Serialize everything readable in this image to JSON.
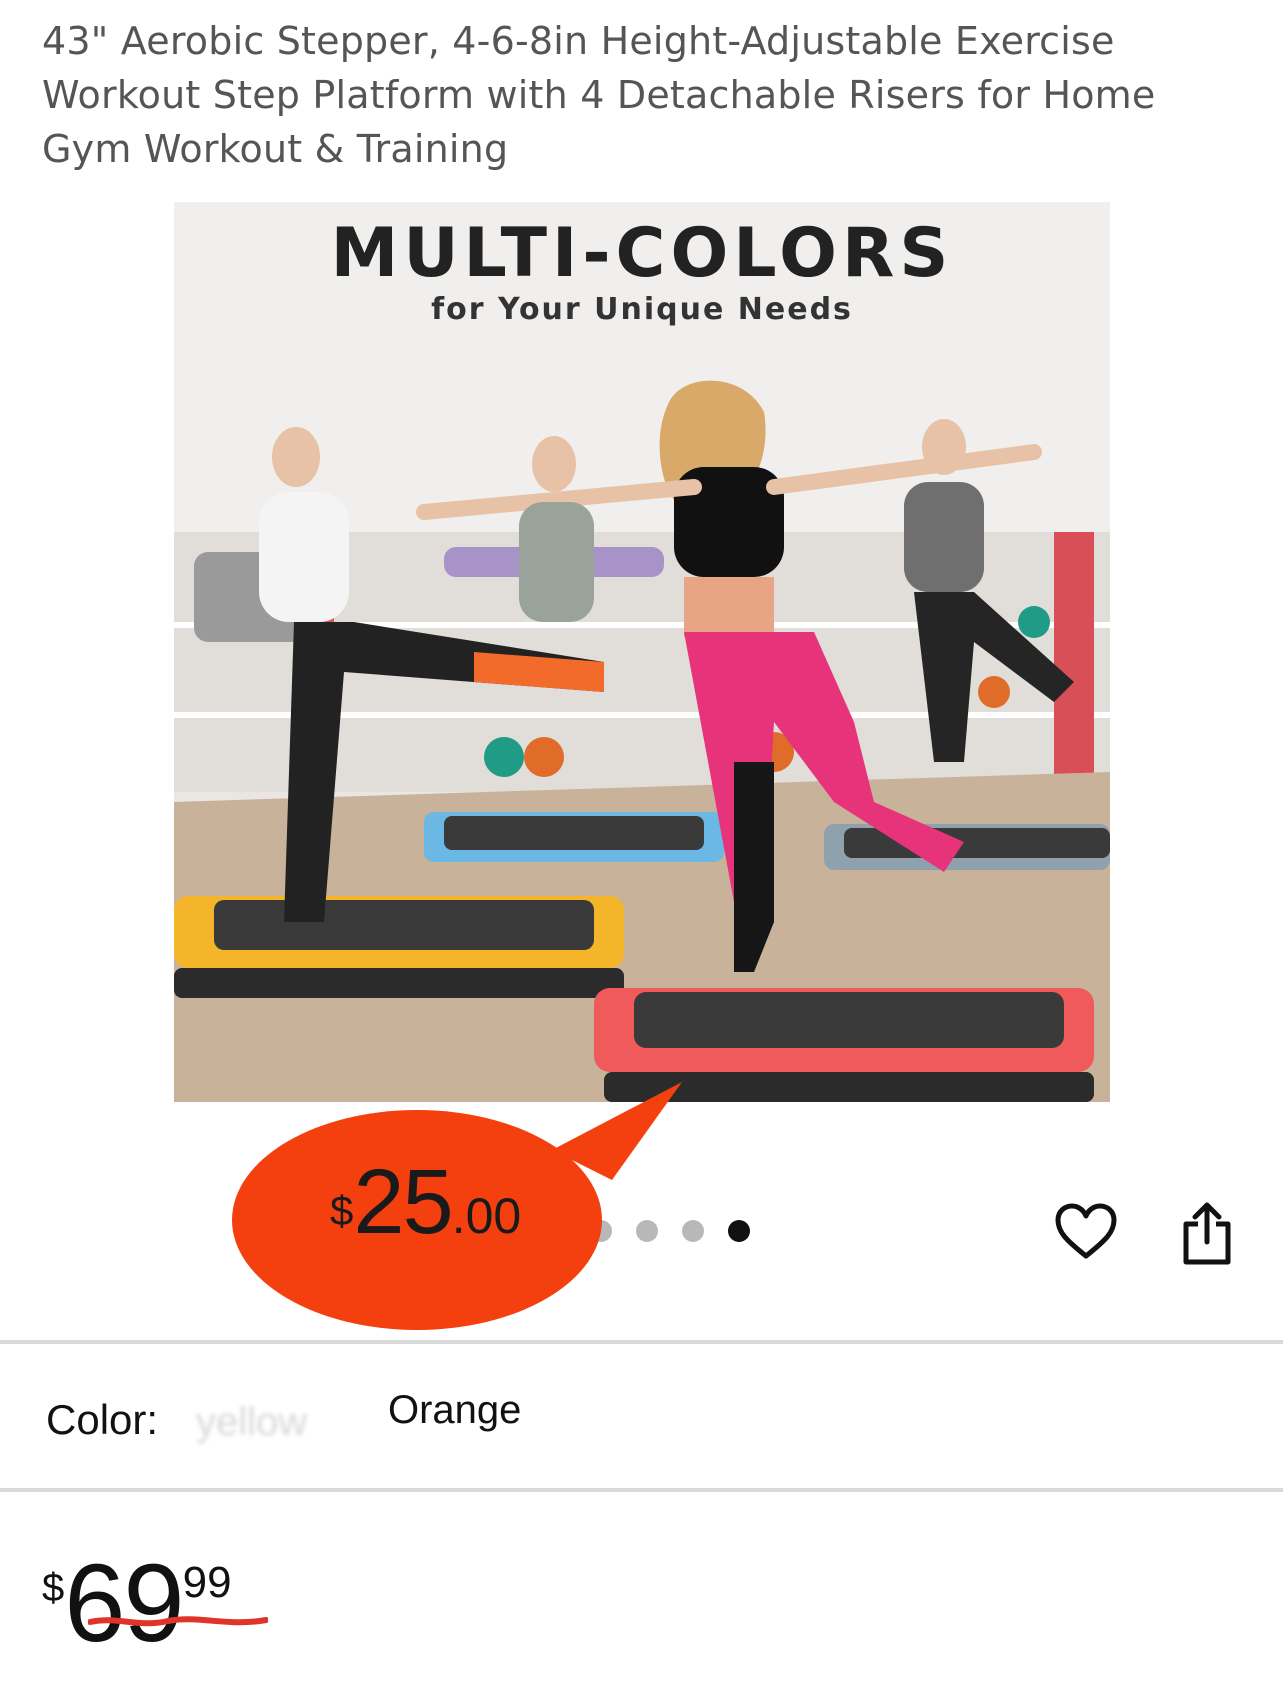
{
  "product": {
    "title": "43\" Aerobic Stepper, 4-6-8in Height-Adjustable Exercise Workout Step Platform with 4 Detachable Risers for Home Gym Workout & Training"
  },
  "image": {
    "headline": "MULTI-COLORS",
    "subhead": "for Your Unique Needs",
    "carousel_total": 4,
    "carousel_active": 4
  },
  "sale_bubble": {
    "currency": "$",
    "whole": "25",
    "cents": ".00",
    "color": "#f4400f"
  },
  "actions": {
    "favorite_icon": "heart-icon",
    "share_icon": "share-icon"
  },
  "color_selector": {
    "label": "Color:",
    "obscured_value": "yellow",
    "value": "Orange"
  },
  "price": {
    "currency": "$",
    "whole": "69",
    "cents": "99",
    "strike_color": "#e0342a"
  }
}
